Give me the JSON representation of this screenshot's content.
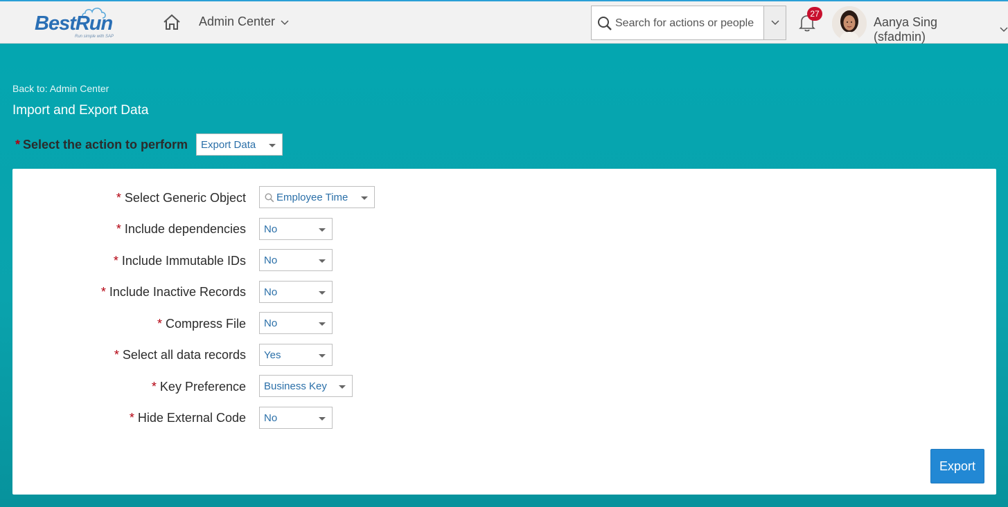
{
  "brand": {
    "logo_text": "BestRun",
    "tagline": "Run simple with SAP"
  },
  "header": {
    "nav_label": "Admin Center",
    "search_placeholder": "Search for actions or people",
    "notification_count": "27",
    "user_name": "Aanya Sing (sfadmin)"
  },
  "page": {
    "back_link": "Back to: Admin Center",
    "title": "Import and Export Data",
    "action_label": "Select the action to perform",
    "action_value": "Export Data"
  },
  "form": {
    "required_marker": "*",
    "fields": [
      {
        "label": "Select Generic Object",
        "value": "Employee Time"
      },
      {
        "label": "Include dependencies",
        "value": "No"
      },
      {
        "label": "Include Immutable IDs",
        "value": "No"
      },
      {
        "label": "Include Inactive Records",
        "value": "No"
      },
      {
        "label": "Compress File",
        "value": "No"
      },
      {
        "label": "Select all data records",
        "value": "Yes"
      },
      {
        "label": "Key Preference",
        "value": "Business Key"
      },
      {
        "label": "Hide External Code",
        "value": "No"
      }
    ],
    "export_label": "Export"
  },
  "colors": {
    "shell_bg": "#f2f2f2",
    "teal": "#04a6b0",
    "accent_blue": "#2288d4",
    "required_red": "#b3000f",
    "badge_red": "#c8102e"
  },
  "icons": {
    "home": "home-icon",
    "nav_chevron": "chevron-down-icon",
    "search": "search-icon",
    "bell": "bell-icon",
    "field_search": "search-icon"
  }
}
